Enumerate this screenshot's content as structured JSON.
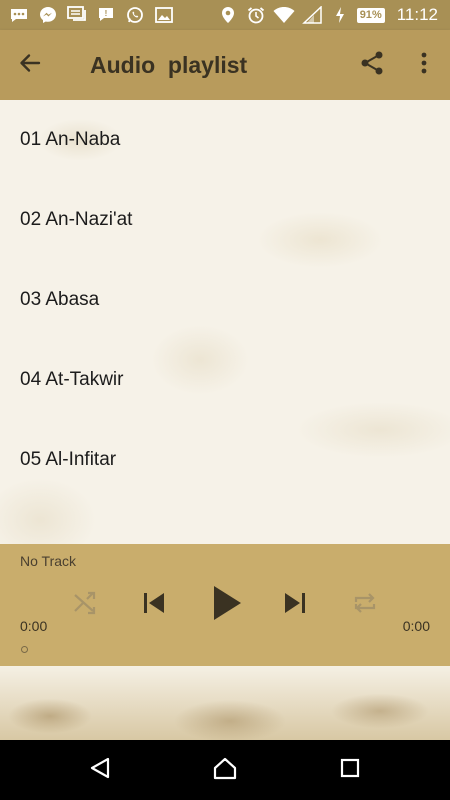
{
  "status_bar": {
    "time": "11:12",
    "battery": "91",
    "icons": [
      "sms-icon",
      "messenger-icon",
      "message-icon",
      "mail-icon",
      "whatsapp-icon",
      "gallery-icon",
      "location-icon",
      "alarm-icon",
      "wifi-icon",
      "signal-icon",
      "charging-icon"
    ]
  },
  "app_bar": {
    "title": "Audio  playlist",
    "back_icon": "back-arrow-icon",
    "share_icon": "share-icon",
    "more_icon": "more-vert-icon"
  },
  "tracks": [
    {
      "label": "01 An-Naba"
    },
    {
      "label": "02 An-Nazi'at"
    },
    {
      "label": "03 Abasa"
    },
    {
      "label": "04 At-Takwir"
    },
    {
      "label": "05 Al-Infitar"
    }
  ],
  "player": {
    "now_playing": "No Track",
    "current_time": "0:00",
    "total_time": "0:00",
    "progress": 0,
    "controls": [
      "shuffle-icon",
      "previous-icon",
      "play-icon",
      "next-icon",
      "repeat-icon"
    ]
  },
  "colors": {
    "app_bar": "#b89b5c",
    "status_bar": "#a89055",
    "player": "#c9ad6c",
    "icon_dark": "#3a3222"
  }
}
